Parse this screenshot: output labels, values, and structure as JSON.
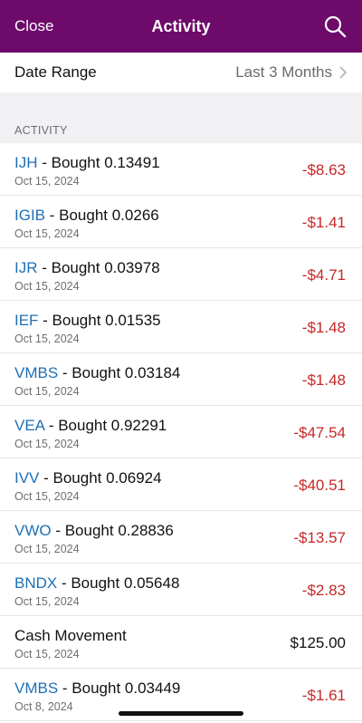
{
  "nav": {
    "close_label": "Close",
    "title": "Activity",
    "search_icon": "search-icon",
    "color": "#6d0a6a"
  },
  "date_range": {
    "label": "Date Range",
    "value": "Last 3 Months"
  },
  "section_header": "ACTIVITY",
  "rows": [
    {
      "ticker": "IJH",
      "action": " - Bought 0.13491",
      "date": "Oct 15, 2024",
      "amount": "-$8.63",
      "negative": true
    },
    {
      "ticker": "IGIB",
      "action": " - Bought 0.0266",
      "date": "Oct 15, 2024",
      "amount": "-$1.41",
      "negative": true
    },
    {
      "ticker": "IJR",
      "action": " - Bought 0.03978",
      "date": "Oct 15, 2024",
      "amount": "-$4.71",
      "negative": true
    },
    {
      "ticker": "IEF",
      "action": " - Bought 0.01535",
      "date": "Oct 15, 2024",
      "amount": "-$1.48",
      "negative": true
    },
    {
      "ticker": "VMBS",
      "action": " - Bought 0.03184",
      "date": "Oct 15, 2024",
      "amount": "-$1.48",
      "negative": true
    },
    {
      "ticker": "VEA",
      "action": " - Bought 0.92291",
      "date": "Oct 15, 2024",
      "amount": "-$47.54",
      "negative": true
    },
    {
      "ticker": "IVV",
      "action": " - Bought 0.06924",
      "date": "Oct 15, 2024",
      "amount": "-$40.51",
      "negative": true
    },
    {
      "ticker": "VWO",
      "action": " - Bought 0.28836",
      "date": "Oct 15, 2024",
      "amount": "-$13.57",
      "negative": true
    },
    {
      "ticker": "BNDX",
      "action": " - Bought 0.05648",
      "date": "Oct 15, 2024",
      "amount": "-$2.83",
      "negative": true
    },
    {
      "ticker": "",
      "action": "Cash Movement",
      "date": "Oct 15, 2024",
      "amount": "$125.00",
      "negative": false
    },
    {
      "ticker": "VMBS",
      "action": " - Bought 0.03449",
      "date": "Oct 8, 2024",
      "amount": "-$1.61",
      "negative": true
    }
  ],
  "colors": {
    "ticker": "#1f6fb5",
    "negative": "#c62828",
    "section_bg": "#f1f1f3"
  }
}
